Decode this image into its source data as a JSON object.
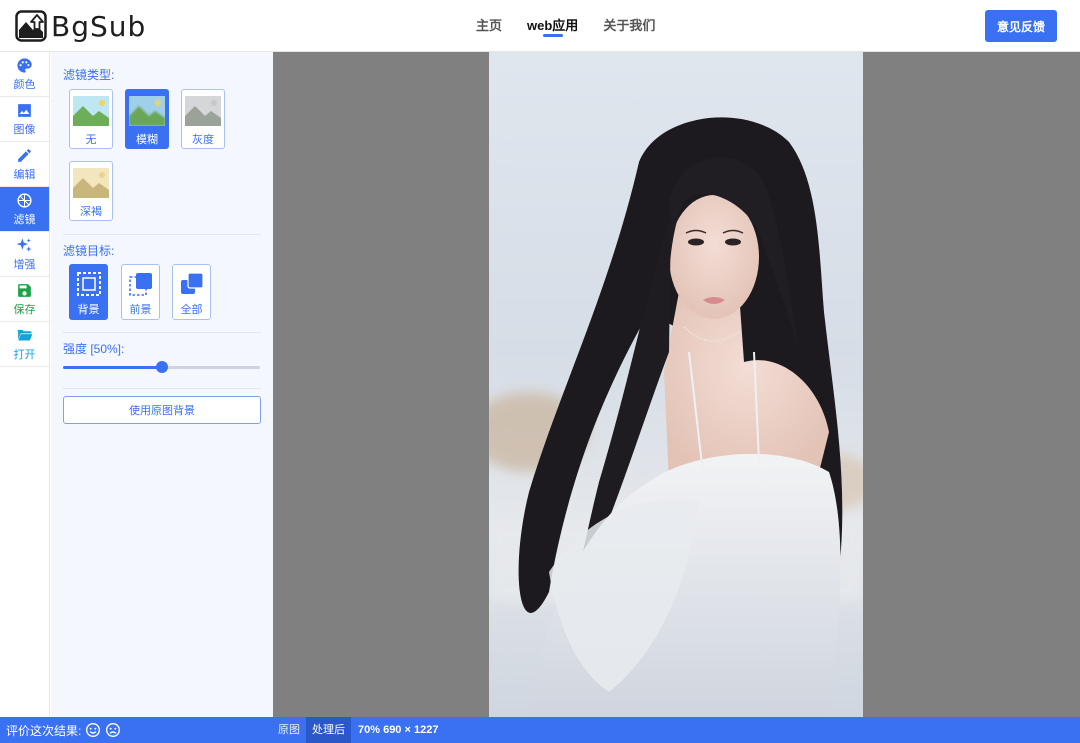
{
  "app": {
    "logo_text": "BgSub",
    "brand_color": "#3a71f2"
  },
  "nav": {
    "items": [
      {
        "label": "主页"
      },
      {
        "label": "web应用"
      },
      {
        "label": "关于我们"
      }
    ],
    "active": "web应用",
    "feedback_label": "意见反馈"
  },
  "sidebar": {
    "items": [
      {
        "label": "颜色",
        "icon": "palette-icon"
      },
      {
        "label": "图像",
        "icon": "image-icon"
      },
      {
        "label": "编辑",
        "icon": "pencil-icon"
      },
      {
        "label": "滤镜",
        "icon": "aperture-icon",
        "active": true
      },
      {
        "label": "增强",
        "icon": "sparkles-icon"
      },
      {
        "label": "保存",
        "icon": "floppy-disk-icon"
      },
      {
        "label": "打开",
        "icon": "folder-open-icon"
      }
    ]
  },
  "panel": {
    "filter_type_title": "滤镜类型:",
    "filters": [
      {
        "label": "无"
      },
      {
        "label": "模糊",
        "active": true
      },
      {
        "label": "灰度"
      },
      {
        "label": "深褐"
      }
    ],
    "filter_target_title": "滤镜目标:",
    "targets": [
      {
        "label": "背景",
        "active": true
      },
      {
        "label": "前景"
      },
      {
        "label": "全部"
      }
    ],
    "strength_label": "强度 [50%]:",
    "strength_value": 50,
    "use_original_bg_label": "使用原图背景"
  },
  "status": {
    "rate_label": "评价这次结果:",
    "rate_icons": [
      "smile-icon",
      "frown-icon"
    ],
    "view_tabs": [
      {
        "label": "原图"
      },
      {
        "label": "处理后",
        "active": true
      }
    ],
    "zoom_info": "70% 690 × 1227"
  }
}
